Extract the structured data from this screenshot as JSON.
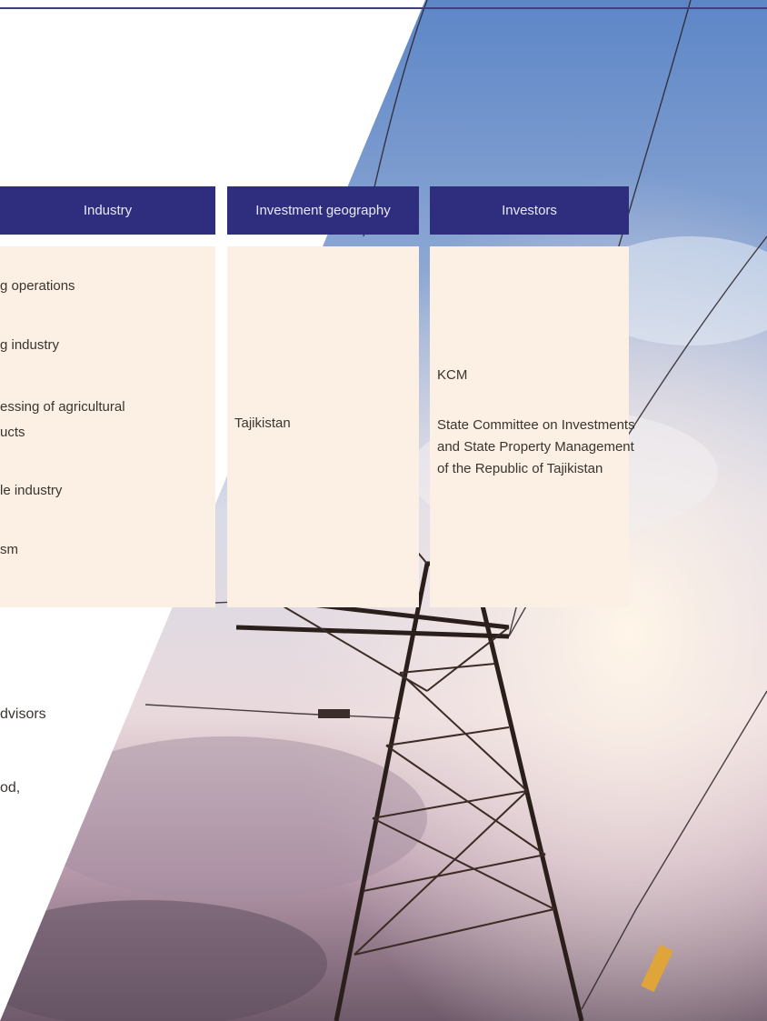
{
  "table": {
    "headers": {
      "industry": "Industry",
      "geography": "Investment geography",
      "investors": "Investors"
    },
    "industry_items": [
      "g operations",
      "g industry",
      "essing of agricultural",
      "ucts",
      "le industry",
      "sm"
    ],
    "geography_value": "Tajikistan",
    "investors_items": [
      "KCM",
      "State Committee on Investments and State Property Management of the Republic of Tajikistan"
    ]
  },
  "fragments": {
    "advisors": "dvisors",
    "od": "od,"
  },
  "colors": {
    "header_bg": "#2f2e7e",
    "body_bg": "#fbf0e3",
    "rule": "#3c4080"
  }
}
